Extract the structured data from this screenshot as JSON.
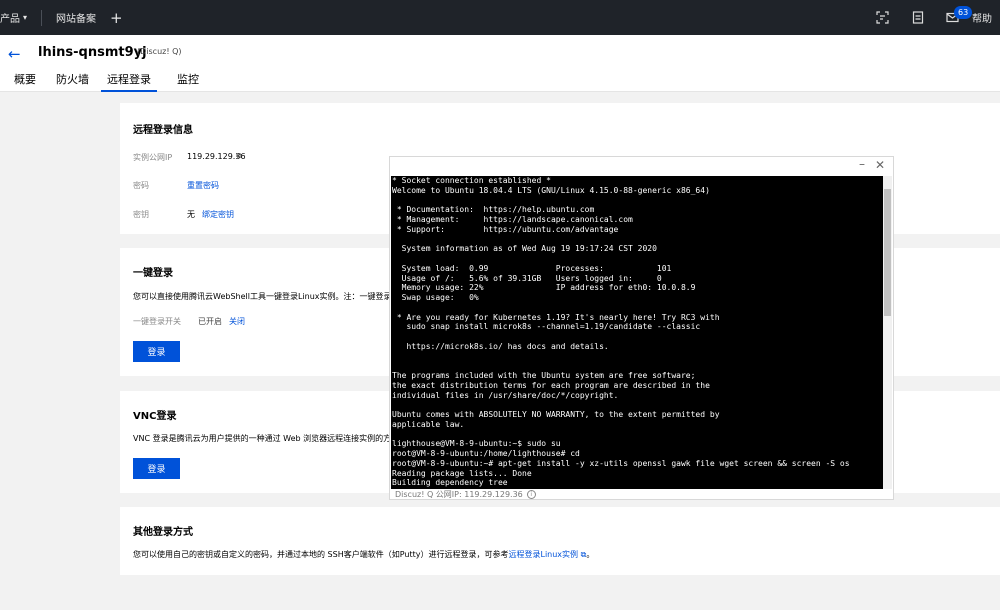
{
  "topnav": {
    "products_label": "产品",
    "record_label": "网站备案",
    "plus": "+",
    "badge_count": "63",
    "help_label": "帮助",
    "icons": [
      "qr-scan-icon",
      "document-icon",
      "mail-icon"
    ]
  },
  "header": {
    "back": "←",
    "instance_name": "lhins-qnsmt9yj",
    "instance_tag": "(Discuz! Q)",
    "tabs": [
      "概要",
      "防火墙",
      "远程登录",
      "监控"
    ],
    "active_tab": "远程登录"
  },
  "remote_info": {
    "title": "远程登录信息",
    "ip_label": "实例公网IP",
    "ip_value": "119.29.129.36",
    "password_label": "密码",
    "password_link": "重置密码",
    "key_label": "密钥",
    "key_value": "无",
    "key_link": "绑定密钥"
  },
  "one_click": {
    "title": "一键登录",
    "desc": "您可以直接使用腾讯云WebShell工具一键登录Linux实例。注：一键登录",
    "switch_label": "一键登录开关",
    "switch_status": "已开启",
    "switch_link": "关闭",
    "button": "登录"
  },
  "vnc": {
    "title": "VNC登录",
    "desc": "VNC 登录是腾讯云为用户提供的一种通过 Web 浏览器远程连接实例的方",
    "button": "登录"
  },
  "other": {
    "title": "其他登录方式",
    "desc_prefix": "您可以使用自己的密钥或自定义的密码，并通过本地的 SSH客户端软件（如Putty）进行远程登录，可参考",
    "desc_link": "远程登录Linux实例",
    "desc_suffix": "。"
  },
  "terminal": {
    "minimize": "–",
    "close": "✕",
    "footer": "Discuz! Q 公网IP: 119.29.129.36",
    "info": "i",
    "lines": [
      "* Socket connection established *",
      "Welcome to Ubuntu 18.04.4 LTS (GNU/Linux 4.15.0-88-generic x86_64)",
      "",
      " * Documentation:  https://help.ubuntu.com",
      " * Management:     https://landscape.canonical.com",
      " * Support:        https://ubuntu.com/advantage",
      "",
      "  System information as of Wed Aug 19 19:17:24 CST 2020",
      "",
      "  System load:  0.99              Processes:           101",
      "  Usage of /:   5.6% of 39.31GB   Users logged in:     0",
      "  Memory usage: 22%               IP address for eth0: 10.0.8.9",
      "  Swap usage:   0%",
      "",
      " * Are you ready for Kubernetes 1.19? It's nearly here! Try RC3 with",
      "   sudo snap install microk8s --channel=1.19/candidate --classic",
      "",
      "   https://microk8s.io/ has docs and details.",
      "",
      "",
      "The programs included with the Ubuntu system are free software;",
      "the exact distribution terms for each program are described in the",
      "individual files in /usr/share/doc/*/copyright.",
      "",
      "Ubuntu comes with ABSOLUTELY NO WARRANTY, to the extent permitted by",
      "applicable law.",
      "",
      "lighthouse@VM-8-9-ubuntu:~$ sudo su",
      "root@VM-8-9-ubuntu:/home/lighthouse# cd",
      "root@VM-8-9-ubuntu:~# apt-get install -y xz-utils openssl gawk file wget screen && screen -S os",
      "Reading package lists... Done",
      "Building dependency tree"
    ]
  }
}
